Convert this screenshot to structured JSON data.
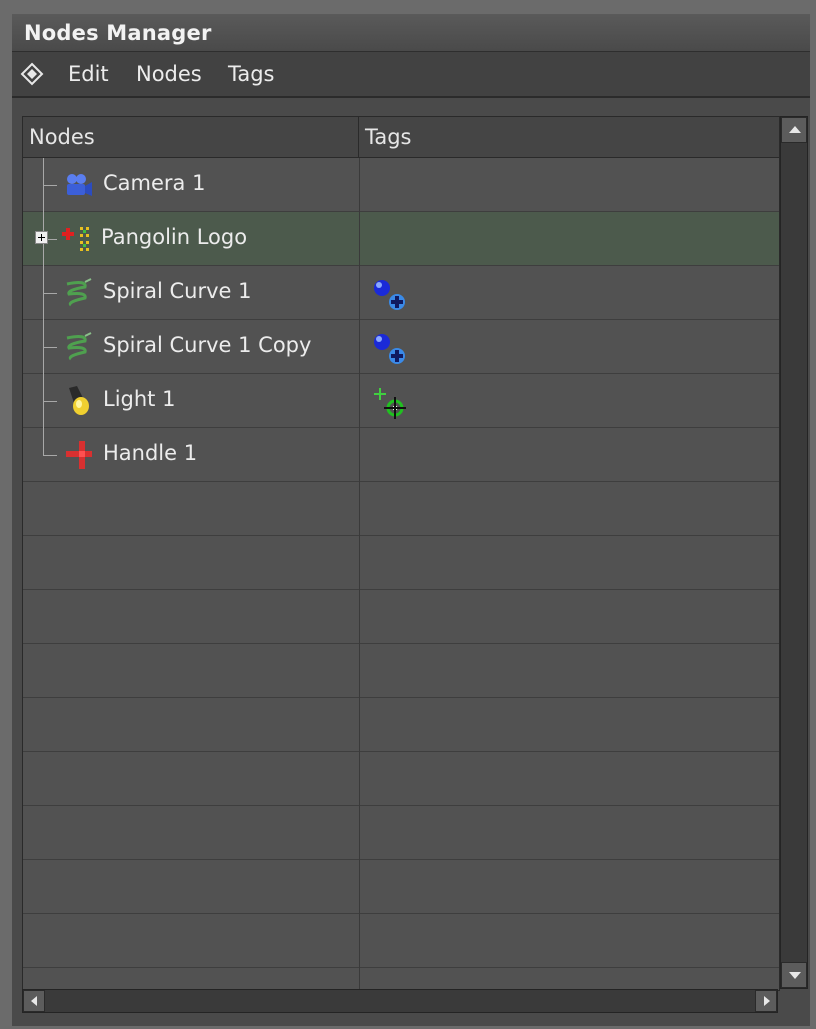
{
  "window": {
    "title": "Nodes Manager"
  },
  "menu": {
    "icon": "diamond-menu-icon",
    "items": [
      "Edit",
      "Nodes",
      "Tags"
    ]
  },
  "table": {
    "columns": [
      "Nodes",
      "Tags"
    ],
    "rows": [
      {
        "label": "Camera 1",
        "icon": "camera-icon",
        "tag": ""
      },
      {
        "label": "Pangolin Logo",
        "icon": "group-node-icon",
        "tag": "",
        "selected": true,
        "expandable": true
      },
      {
        "label": "Spiral Curve 1",
        "icon": "spiral-curve-icon",
        "tag": "motion-tag-icon"
      },
      {
        "label": "Spiral Curve 1 Copy",
        "icon": "spiral-curve-icon",
        "tag": "motion-tag-icon"
      },
      {
        "label": "Light 1",
        "icon": "light-bulb-icon",
        "tag": "target-tag-icon"
      },
      {
        "label": "Handle 1",
        "icon": "handle-icon",
        "tag": ""
      }
    ]
  },
  "colors": {
    "selected_row": "#4c5a4c",
    "row": "#525252",
    "background": "#4a4a4a"
  }
}
